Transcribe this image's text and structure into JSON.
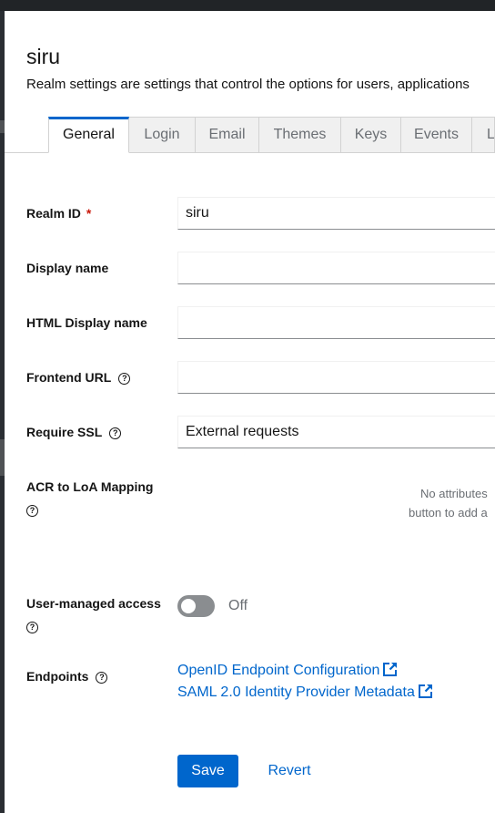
{
  "realm": {
    "title": "siru",
    "description": "Realm settings are settings that control the options for users, applications"
  },
  "tabs": [
    {
      "label": "General",
      "active": true
    },
    {
      "label": "Login"
    },
    {
      "label": "Email"
    },
    {
      "label": "Themes"
    },
    {
      "label": "Keys"
    },
    {
      "label": "Events"
    },
    {
      "label": "L"
    }
  ],
  "form": {
    "realm_id": {
      "label": "Realm ID",
      "required_mark": "*",
      "value": "siru"
    },
    "display_name": {
      "label": "Display name",
      "value": ""
    },
    "html_display_name": {
      "label": "HTML Display name",
      "value": ""
    },
    "frontend_url": {
      "label": "Frontend URL",
      "value": ""
    },
    "require_ssl": {
      "label": "Require SSL",
      "value": "External requests"
    },
    "acr_loa": {
      "label": "ACR to LoA Mapping",
      "empty_line1": "No attributes",
      "empty_line2": "button to add a"
    },
    "user_managed_access": {
      "label": "User-managed access",
      "state_label": "Off",
      "enabled": false
    },
    "endpoints": {
      "label": "Endpoints",
      "links": [
        "OpenID Endpoint Configuration",
        "SAML 2.0 Identity Provider Metadata"
      ]
    }
  },
  "actions": {
    "save_label": "Save",
    "revert_label": "Revert"
  },
  "icons": {
    "help": "help-circle-icon",
    "external": "external-link-icon"
  },
  "colors": {
    "accent": "#0066cc",
    "required": "#c9190b",
    "topbar": "#212427"
  }
}
